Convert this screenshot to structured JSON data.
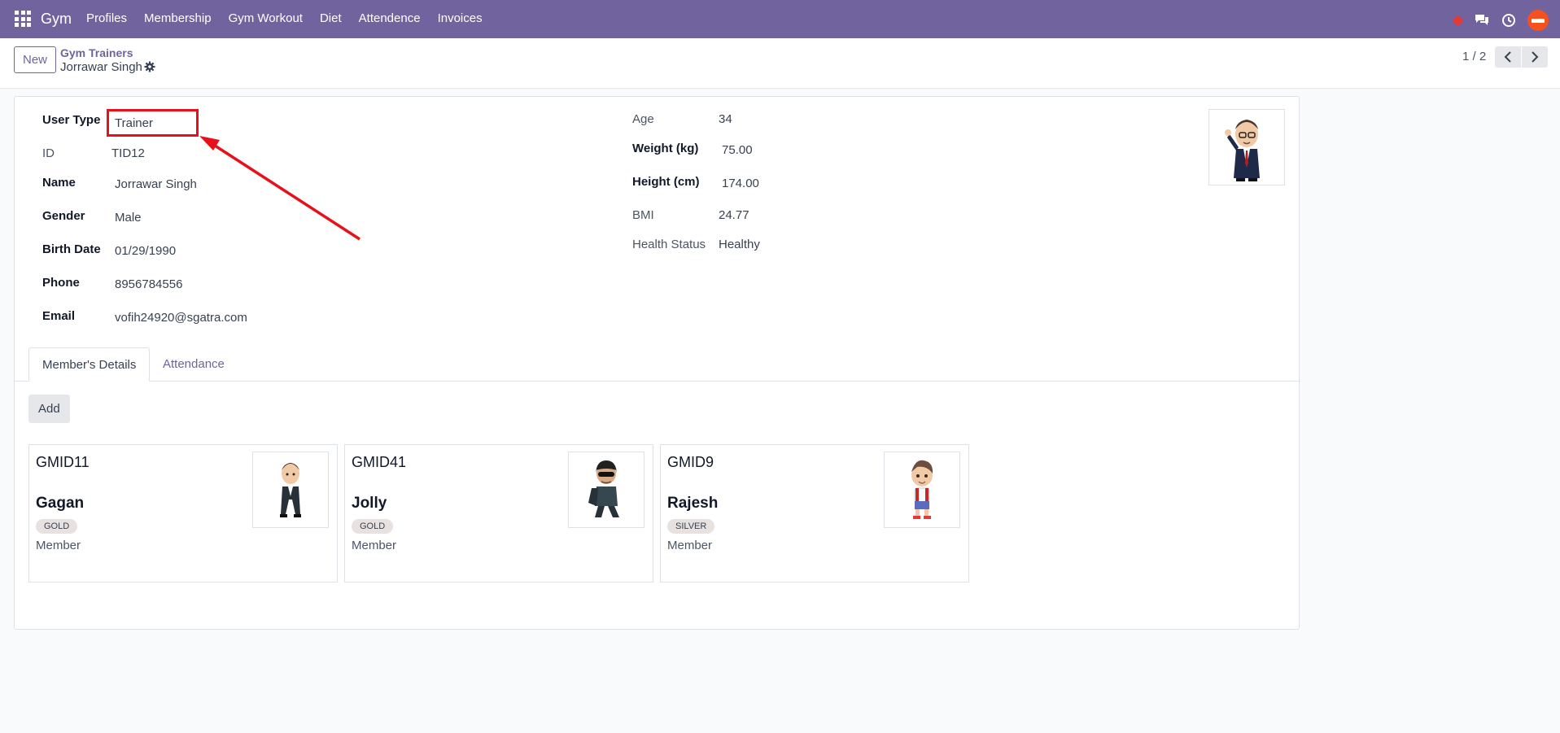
{
  "navbar": {
    "brand": "Gym",
    "menu": [
      "Profiles",
      "Membership",
      "Gym Workout",
      "Diet",
      "Attendence",
      "Invoices"
    ],
    "bg_color": "#71639e"
  },
  "control": {
    "new_label": "New",
    "breadcrumb_parent": "Gym Trainers",
    "breadcrumb_current": "Jorrawar Singh",
    "pager": "1 / 2"
  },
  "form": {
    "left": [
      {
        "label": "User Type",
        "value": "Trainer"
      },
      {
        "label": "ID",
        "value": "TID12"
      },
      {
        "label": "Name",
        "value": "Jorrawar Singh"
      },
      {
        "label": "Gender",
        "value": "Male"
      },
      {
        "label": "Birth Date",
        "value": "01/29/1990"
      },
      {
        "label": "Phone",
        "value": "8956784556"
      },
      {
        "label": "Email",
        "value": "vofih24920@sgatra.com"
      }
    ],
    "right": [
      {
        "label": "Age",
        "value": "34"
      },
      {
        "label": "Weight (kg)",
        "value": "75.00"
      },
      {
        "label": "Height (cm)",
        "value": "174.00"
      },
      {
        "label": "BMI",
        "value": "24.77"
      },
      {
        "label": "Health Status",
        "value": "Healthy"
      }
    ]
  },
  "tabs": [
    "Member's Details",
    "Attendance"
  ],
  "add_label": "Add",
  "cards": [
    {
      "code": "GMID11",
      "name": "Gagan",
      "badge": "GOLD",
      "role": "Member"
    },
    {
      "code": "GMID41",
      "name": "Jolly",
      "badge": "GOLD",
      "role": "Member"
    },
    {
      "code": "GMID9",
      "name": "Rajesh",
      "badge": "SILVER",
      "role": "Member"
    }
  ],
  "annotation_color": "#e8101a"
}
